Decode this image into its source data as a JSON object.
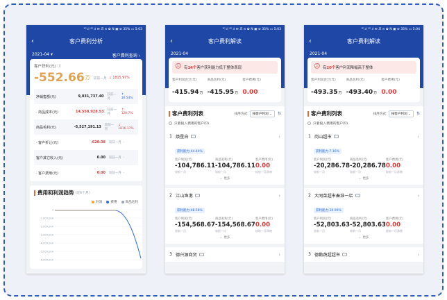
{
  "status_bar": "³ᴳ.ıl ⁴ᴳ.ıl ✉ ♬ ⊙ ✿ N ▣ ⊘ 35% ▭ 5:03",
  "status_bar_3": "³ᴳ.ıl ⁴ᴳ.ıl ✉ ♬ ⊙ ✿ N ▣ ⊘ 35% ▭ 5:04",
  "screen1": {
    "title": "客户费利分析",
    "period": "2021-04 ▾",
    "link": "客户费利查询 ›",
    "profit_label": "客户获利(元) ⓘ",
    "profit_value": "-552.66",
    "profit_unit": "万",
    "compare": "较前一月",
    "compare_value": "↓ 1815.97%",
    "rows": [
      {
        "label": "净销售额(元)",
        "value": "9,031,737.40",
        "cmp": "较前一月",
        "delta": "↑ 30.54%",
        "delta_color": "blue",
        "value_color": "normal"
      },
      {
        "label": "· 商品成本(元)",
        "value": "14,558,928.53",
        "cmp": "较前一月",
        "delta": "↑ 120.7%",
        "delta_color": "red",
        "value_color": "red"
      },
      {
        "label": "商品毛利(元)",
        "value": "-5,527,191.13",
        "cmp": "较前一月",
        "delta": "↓ 1816.17%",
        "delta_color": "red",
        "value_color": "normal"
      },
      {
        "label": "· 客户折让(元)",
        "value": "-620.08",
        "cmp": "较前一月",
        "delta": "-",
        "delta_color": "muted",
        "value_color": "red"
      },
      {
        "label": "客户其它收入(元)",
        "value": "0.00",
        "cmp": "较前一月",
        "delta": "-",
        "delta_color": "muted",
        "value_color": "normal"
      },
      {
        "label": "· 客户费用(元)",
        "value": "0.00",
        "cmp": "较前一月",
        "delta": "-",
        "delta_color": "muted",
        "value_color": "red"
      }
    ],
    "trend_title": "费用和利润趋势",
    "trend_sub": "(近6个月)",
    "legend": [
      "利润",
      "费用",
      "商品毛利"
    ],
    "legend_colors": [
      "#f5a623",
      "#2f6bd8",
      "#9aa3b0"
    ],
    "y_ticks": [
      "0",
      "-1,000,000",
      "-2,000,000",
      "-3,000,000",
      "-4,000,000",
      "-5,000,000",
      "-6,000,000"
    ]
  },
  "screen2": {
    "title": "客户费利解读",
    "period": "2021-04",
    "banner_pre": "有",
    "banner_num": "14个",
    "banner_post": "客户获利能力低于整体表现",
    "summary": [
      {
        "label": "客户利润合计(元)",
        "value": "-415.94",
        "unit": "万",
        "color": "normal"
      },
      {
        "label": "商品毛利(元)",
        "value": "-415.95",
        "unit": "万",
        "color": "normal"
      },
      {
        "label": "客户费用(元)",
        "value": "0.00",
        "unit": "",
        "color": "red"
      }
    ],
    "list_title": "客户费利列表",
    "sort_label": "排序方式:",
    "sort_value": "按客户利润 ⌄",
    "checkbox_label": "只看投入费用的客户(0)",
    "items": [
      {
        "rank": "1",
        "name": "焕星白",
        "tag": "获利能力-44.44%",
        "labels": [
          "客户利润(元)",
          "商品毛利(元)",
          "客户费用(元)"
        ],
        "values": [
          "-104,786.11",
          "-104,786.11",
          "0.00"
        ],
        "cmps": [
          "较前一月",
          "较前一月",
          "较前一月净增"
        ],
        "more": "更多"
      },
      {
        "rank": "2",
        "name": "江山渔港",
        "tag": "获利能力-48.58%",
        "labels": [
          "客户利润(元)",
          "商品毛利(元)",
          "客户费用(元)"
        ],
        "values": [
          "-154,568.67",
          "-154,568.67",
          "0.00"
        ],
        "cmps": [
          "较前一月",
          "较前一月",
          "较前一月净增"
        ],
        "more": "更多"
      },
      {
        "rank": "3",
        "name": "德兴源商贸",
        "tag": "",
        "labels": [],
        "values": [],
        "cmps": [],
        "more": ""
      }
    ]
  },
  "screen3": {
    "title": "客户费利解读",
    "period": "2021-04",
    "banner_pre": "有",
    "banner_num": "20个",
    "banner_post": "客户利润降幅高于整体",
    "summary": [
      {
        "label": "客户利润合计(元)",
        "value": "-493.35",
        "unit": "万",
        "color": "normal"
      },
      {
        "label": "商品毛利(元)",
        "value": "-493.40",
        "unit": "万",
        "color": "normal"
      },
      {
        "label": "客户费用(元)",
        "value": "0.00",
        "unit": "",
        "color": "red"
      }
    ],
    "list_title": "客户费利列表",
    "sort_label": "排序方式:",
    "sort_value": "按客户利润 ⌄",
    "checkbox_label": "只看投入费用的客户(0)",
    "items": [
      {
        "rank": "1",
        "name": "岗山超市",
        "tag": "获利能力-7.16%",
        "labels": [
          "客户利润(元)",
          "商品毛利(元)",
          "客户费用(元)"
        ],
        "values": [
          "-20,286.78",
          "-20,286.78",
          "0.00"
        ],
        "cmps": [
          "较前一月",
          "较前一月",
          "较前一月净增"
        ],
        "more": "更多"
      },
      {
        "rank": "2",
        "name": "大同菜超市秦淮一店",
        "tag": "获利能力-30.99%",
        "labels": [
          "客户利润(元)",
          "商品毛利(元)",
          "客户费用(元)"
        ],
        "values": [
          "-52,803.63",
          "-52,803.63",
          "0.00"
        ],
        "cmps": [
          "较前一月",
          "较前一月",
          "较前一月净增"
        ],
        "more": "更多"
      },
      {
        "rank": "3",
        "name": "德勤蔬超超市",
        "tag": "",
        "labels": [],
        "values": [],
        "cmps": [],
        "more": ""
      }
    ]
  }
}
